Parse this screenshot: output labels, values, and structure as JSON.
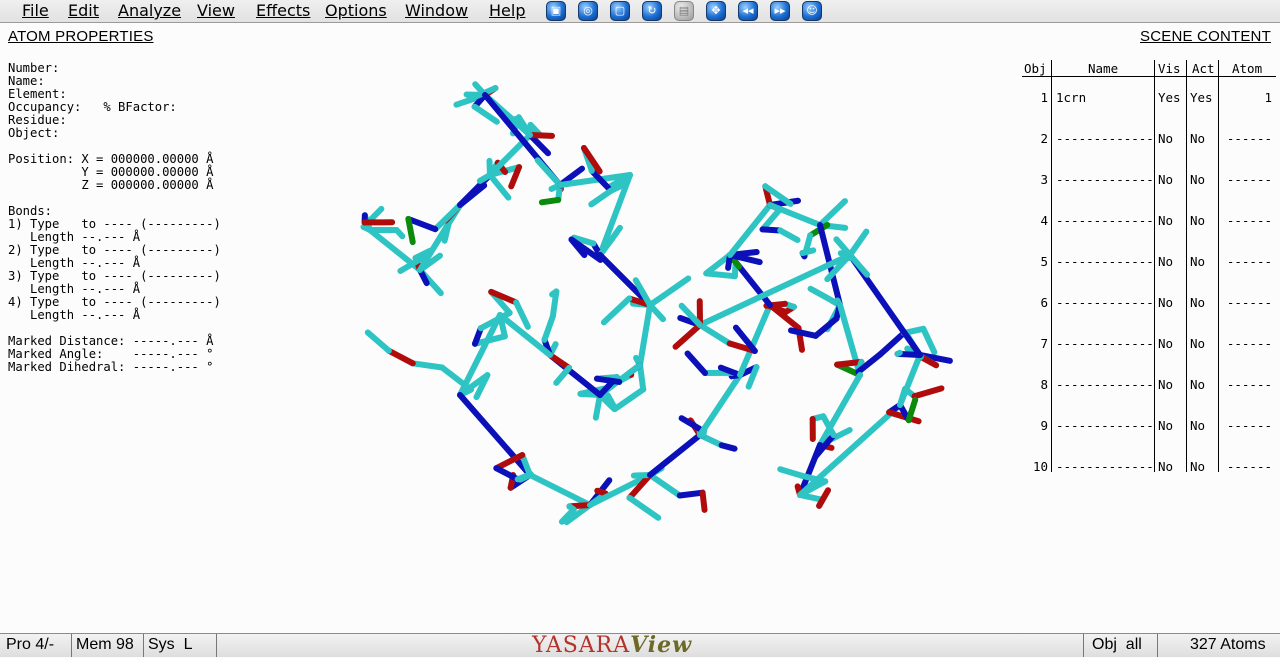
{
  "menu": {
    "file": "File",
    "edit": "Edit",
    "analyze": "Analyze",
    "view": "View",
    "effects": "Effects",
    "options": "Options",
    "window": "Window",
    "help": "Help"
  },
  "toolbar_icons": [
    "select-icon",
    "globe-icon",
    "new-page-icon",
    "refresh-icon",
    "save-icon",
    "move-icon",
    "rewind-icon",
    "fast-forward-icon",
    "smiley-icon"
  ],
  "atom_properties": {
    "title": "ATOM PROPERTIES",
    "lines": [
      "Number:",
      "Name:",
      "Element:",
      "Occupancy:   % BFactor:",
      "Residue:",
      "Object:",
      "",
      "Position: X = 000000.00000 Å",
      "          Y = 000000.00000 Å",
      "          Z = 000000.00000 Å",
      "",
      "Bonds:",
      "1) Type   to ---- (---------)",
      "   Length --.--- Å",
      "2) Type   to ---- (---------)",
      "   Length --.--- Å",
      "3) Type   to ---- (---------)",
      "   Length --.--- Å",
      "4) Type   to ---- (---------)",
      "   Length --.--- Å",
      "",
      "Marked Distance: -----.--- Å",
      "Marked Angle:    -----.--- °",
      "Marked Dihedral: -----.--- °"
    ]
  },
  "scene_content": {
    "title": "SCENE CONTENT",
    "columns": [
      "Obj",
      "Name",
      "Vis",
      "Act",
      "Atom"
    ],
    "rows": [
      {
        "obj": "1",
        "name": "1crn",
        "vis": "Yes",
        "act": "Yes",
        "atom": "1"
      },
      {
        "obj": "2",
        "name": "-------------",
        "vis": "No",
        "act": "No",
        "atom": "------"
      },
      {
        "obj": "3",
        "name": "-------------",
        "vis": "No",
        "act": "No",
        "atom": "------"
      },
      {
        "obj": "4",
        "name": "-------------",
        "vis": "No",
        "act": "No",
        "atom": "------"
      },
      {
        "obj": "5",
        "name": "-------------",
        "vis": "No",
        "act": "No",
        "atom": "------"
      },
      {
        "obj": "6",
        "name": "-------------",
        "vis": "No",
        "act": "No",
        "atom": "------"
      },
      {
        "obj": "7",
        "name": "-------------",
        "vis": "No",
        "act": "No",
        "atom": "------"
      },
      {
        "obj": "8",
        "name": "-------------",
        "vis": "No",
        "act": "No",
        "atom": "------"
      },
      {
        "obj": "9",
        "name": "-------------",
        "vis": "No",
        "act": "No",
        "atom": "------"
      },
      {
        "obj": "10",
        "name": "-------------",
        "vis": "No",
        "act": "No",
        "atom": "------"
      }
    ]
  },
  "status": {
    "pro": "Pro 4/-",
    "mem": "Mem 98",
    "sys": "Sys  L",
    "logo_a": "YASARA",
    "logo_b": "View",
    "obj": "Obj  all",
    "atoms": "327 Atoms"
  },
  "colors": {
    "carbon": "#2fc4c4",
    "nitrogen": "#0b10b8",
    "oxygen": "#b00c0c",
    "sulfur": "#0c8a0c"
  }
}
